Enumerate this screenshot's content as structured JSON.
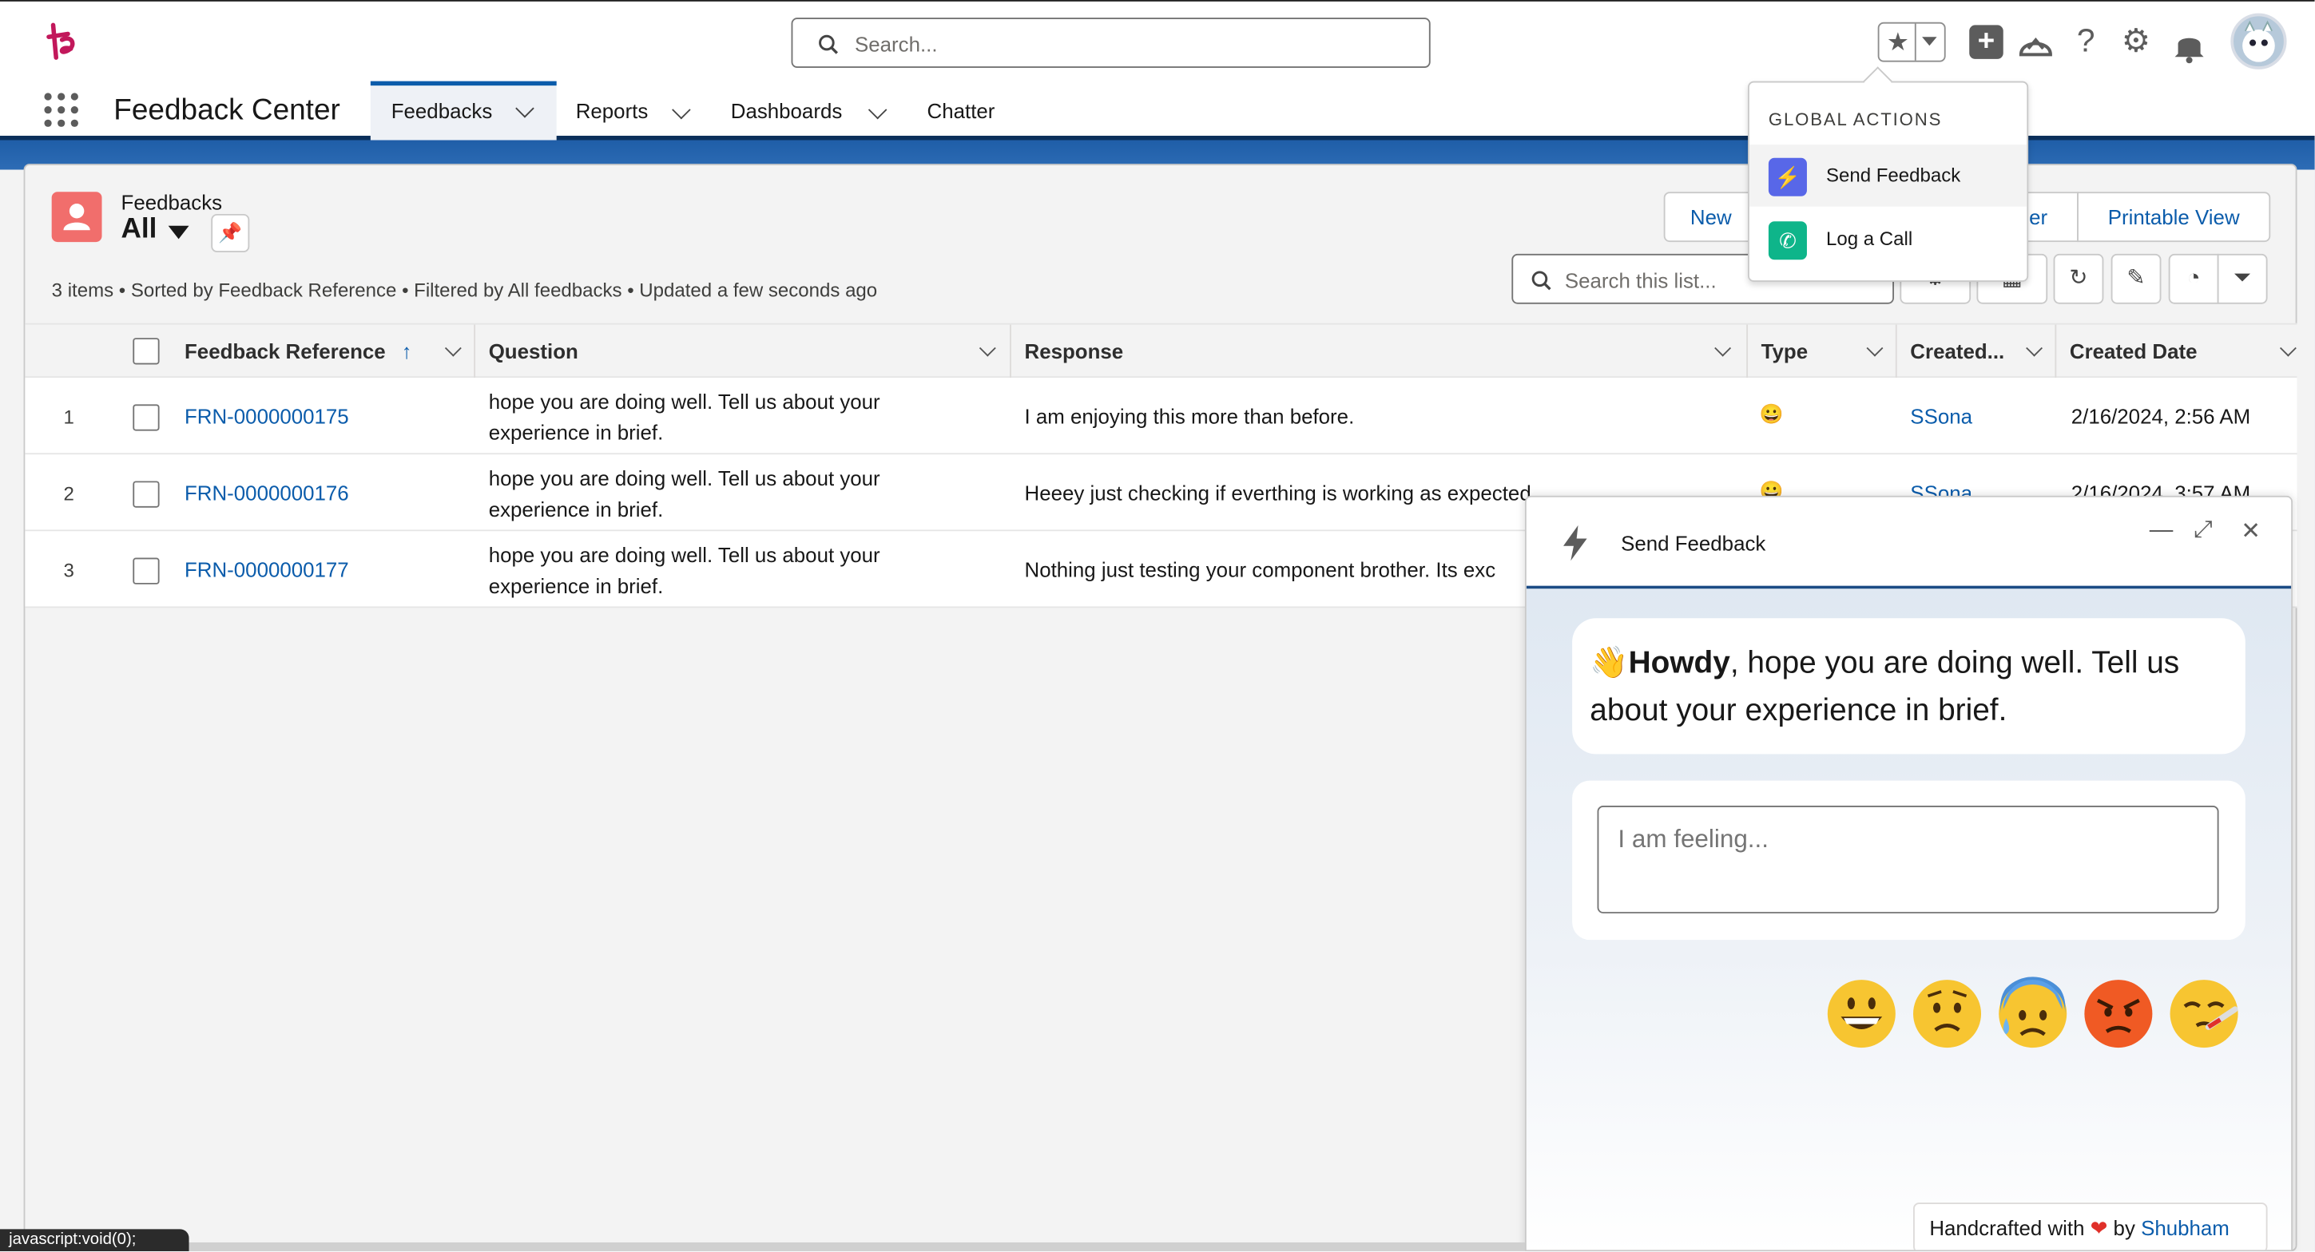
{
  "header": {
    "search_placeholder": "Search...",
    "icons": [
      "favorites-star-icon",
      "add-plus-icon",
      "trailhead-icon",
      "help-icon",
      "setup-gear-icon",
      "notifications-bell-icon",
      "user-avatar"
    ]
  },
  "nav": {
    "app_name": "Feedback Center",
    "tabs": [
      {
        "label": "Feedbacks",
        "active": true,
        "has_menu": true
      },
      {
        "label": "Reports",
        "has_menu": true
      },
      {
        "label": "Dashboards",
        "has_menu": true
      },
      {
        "label": "Chatter",
        "has_menu": false
      }
    ]
  },
  "list": {
    "object_label": "Feedbacks",
    "view_name": "All",
    "meta": "3 items • Sorted by Feedback Reference • Filtered by All feedbacks • Updated a few seconds ago",
    "buttons": {
      "new": "New",
      "change_owner_partial": "er",
      "printable": "Printable View"
    },
    "search_placeholder": "Search this list...",
    "columns": [
      "Feedback Reference",
      "Question",
      "Response",
      "Type",
      "Created...",
      "Created Date"
    ],
    "sort_indicator": "↑",
    "rows": [
      {
        "num": "1",
        "ref": "FRN-0000000175",
        "question": "hope you are doing well. Tell us about your experience in brief.",
        "response": "I am enjoying this more than before.",
        "type": "😀",
        "created_by": "SSona",
        "created_date": "2/16/2024, 2:56 AM"
      },
      {
        "num": "2",
        "ref": "FRN-0000000176",
        "question": "hope you are doing well. Tell us about your experience in brief.",
        "response": "Heeey just checking if everthing is working as expected",
        "type": "😀",
        "created_by": "SSona",
        "created_date": "2/16/2024, 3:57 AM"
      },
      {
        "num": "3",
        "ref": "FRN-0000000177",
        "question": "hope you are doing well. Tell us about your experience in brief.",
        "response": "Nothing just testing your component brother. Its exc",
        "type": "",
        "created_by": "",
        "created_date": ""
      }
    ]
  },
  "global_actions": {
    "title": "GLOBAL ACTIONS",
    "items": [
      {
        "label": "Send Feedback",
        "color": "#5867e8"
      },
      {
        "label": "Log a Call",
        "color": "#0eb58a"
      }
    ]
  },
  "panel": {
    "title": "Send Feedback",
    "greeting_emoji": "👋",
    "greeting_bold": "Howdy",
    "greeting_rest": ", hope you are doing well. Tell us about your experience in brief.",
    "input_placeholder": "I am feeling...",
    "emojis": [
      "grinning-face",
      "worried-face",
      "anxious-face-with-sweat",
      "angry-face",
      "face-with-thermometer"
    ],
    "credit_prefix": "Handcrafted with",
    "credit_heart": "❤",
    "credit_by": "by",
    "credit_name": "Shubham"
  },
  "statusbar": {
    "text": "javascript:void(0);"
  },
  "colors": {
    "brand": "#0b5cab",
    "object_icon": "#f16e6c",
    "nav_band": "#0b2f5a"
  }
}
